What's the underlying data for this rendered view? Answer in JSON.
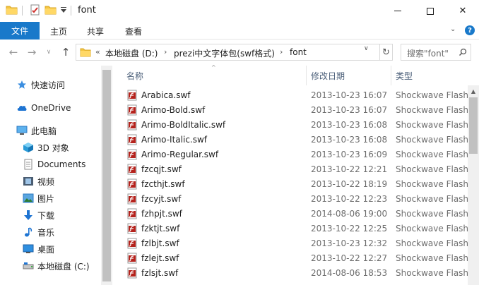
{
  "window": {
    "title": "font",
    "minimize_icon": "minimize-icon",
    "maximize_icon": "maximize-icon",
    "close_glyph": "✕"
  },
  "ribbon": {
    "file": "文件",
    "tabs": [
      "主页",
      "共享",
      "查看"
    ],
    "expand_glyph": "⌄",
    "help_glyph": "?"
  },
  "address": {
    "overflow": "«",
    "segments": [
      "本地磁盘 (D:)",
      "prezi中文字体包(swf格式)",
      "font"
    ],
    "separator": "›",
    "refresh_glyph": "↻",
    "dropdown_glyph": "∨"
  },
  "search": {
    "placeholder": "搜索\"font\""
  },
  "nav": {
    "back": "←",
    "forward": "→",
    "recent": "∨",
    "up": "↑",
    "items": [
      {
        "label": "快速访问",
        "icon": "star-icon"
      },
      {
        "label": "OneDrive",
        "icon": "cloud-icon"
      },
      {
        "label": "此电脑",
        "icon": "computer-icon"
      },
      {
        "label": "3D 对象",
        "icon": "cube-icon"
      },
      {
        "label": "Documents",
        "icon": "document-icon"
      },
      {
        "label": "视频",
        "icon": "video-icon"
      },
      {
        "label": "图片",
        "icon": "picture-icon"
      },
      {
        "label": "下载",
        "icon": "download-icon"
      },
      {
        "label": "音乐",
        "icon": "music-icon"
      },
      {
        "label": "桌面",
        "icon": "desktop-icon"
      },
      {
        "label": "本地磁盘 (C:)",
        "icon": "drive-icon"
      }
    ]
  },
  "columns": {
    "name": "名称",
    "date": "修改日期",
    "type": "类型"
  },
  "files": [
    {
      "name": "Arabica.swf",
      "date": "2013-10-23 16:07",
      "type": "Shockwave Flash..."
    },
    {
      "name": "Arimo-Bold.swf",
      "date": "2013-10-23 16:07",
      "type": "Shockwave Flash..."
    },
    {
      "name": "Arimo-BoldItalic.swf",
      "date": "2013-10-23 16:08",
      "type": "Shockwave Flash..."
    },
    {
      "name": "Arimo-Italic.swf",
      "date": "2013-10-23 16:08",
      "type": "Shockwave Flash..."
    },
    {
      "name": "Arimo-Regular.swf",
      "date": "2013-10-23 16:09",
      "type": "Shockwave Flash..."
    },
    {
      "name": "fzcqjt.swf",
      "date": "2013-10-22 12:21",
      "type": "Shockwave Flash..."
    },
    {
      "name": "fzcthjt.swf",
      "date": "2013-10-22 18:19",
      "type": "Shockwave Flash..."
    },
    {
      "name": "fzcyjt.swf",
      "date": "2013-10-22 12:23",
      "type": "Shockwave Flash..."
    },
    {
      "name": "fzhpjt.swf",
      "date": "2014-08-06 19:00",
      "type": "Shockwave Flash..."
    },
    {
      "name": "fzktjt.swf",
      "date": "2013-10-22 12:25",
      "type": "Shockwave Flash..."
    },
    {
      "name": "fzlbjt.swf",
      "date": "2013-10-23 12:32",
      "type": "Shockwave Flash..."
    },
    {
      "name": "fzlejt.swf",
      "date": "2013-10-22 12:27",
      "type": "Shockwave Flash..."
    },
    {
      "name": "fzlsjt.swf",
      "date": "2014-08-06 18:53",
      "type": "Shockwave Flash..."
    }
  ],
  "colors": {
    "accent": "#1979ca",
    "swf_icon": "#b5221c"
  }
}
